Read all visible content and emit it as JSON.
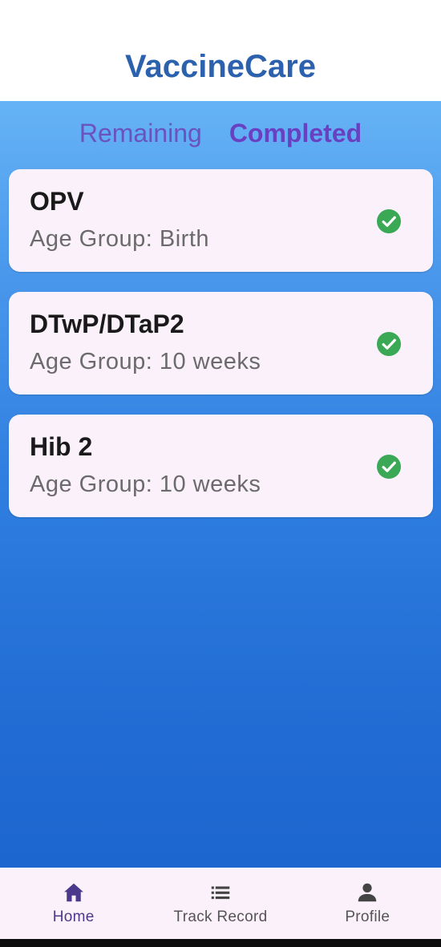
{
  "app": {
    "title": "VaccineCare"
  },
  "tabs": [
    {
      "label": "Remaining",
      "active": false
    },
    {
      "label": "Completed",
      "active": true
    }
  ],
  "vaccines": [
    {
      "name": "OPV",
      "age_group": "Age Group: Birth",
      "status_icon": "check-circle-icon"
    },
    {
      "name": "DTwP/DTaP2",
      "age_group": "Age Group: 10 weeks",
      "status_icon": "check-circle-icon"
    },
    {
      "name": "Hib 2",
      "age_group": "Age Group: 10 weeks",
      "status_icon": "check-circle-icon"
    }
  ],
  "nav": [
    {
      "label": "Home",
      "icon": "home-icon",
      "active": true
    },
    {
      "label": "Track Record",
      "icon": "list-icon",
      "active": false
    },
    {
      "label": "Profile",
      "icon": "person-icon",
      "active": false
    }
  ],
  "colors": {
    "title": "#2c62ad",
    "tab": "#6a52bf",
    "card": "#fbf1fa",
    "check": "#3aa855",
    "nav_active": "#4b3a8c"
  }
}
